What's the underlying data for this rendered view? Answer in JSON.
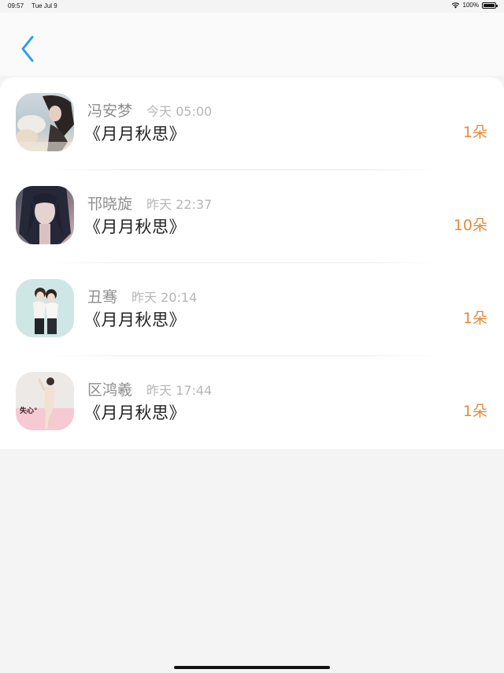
{
  "status_bar": {
    "time": "09:57",
    "date": "Tue Jul 9",
    "battery": "100%"
  },
  "nav": {
    "back_icon": "chevron-left-icon",
    "accent": "#2d9cf0"
  },
  "rows": [
    {
      "name": "冯安梦",
      "time": "今天 05:00",
      "title": "《月月秋思》",
      "count": "1朵"
    },
    {
      "name": "邗晓旋",
      "time": "昨天 22:37",
      "title": "《月月秋思》",
      "count": "10朵"
    },
    {
      "name": "丑骞",
      "time": "昨天 20:14",
      "title": "《月月秋思》",
      "count": "1朵"
    },
    {
      "name": "区鸿羲",
      "time": "昨天 17:44",
      "title": "《月月秋思》",
      "count": "1朵"
    }
  ],
  "avatar_badge_text": "失心°",
  "colors": {
    "count": "#e58a3c",
    "name": "#8e8e8e",
    "time": "#b6b6b6",
    "title": "#222222"
  }
}
